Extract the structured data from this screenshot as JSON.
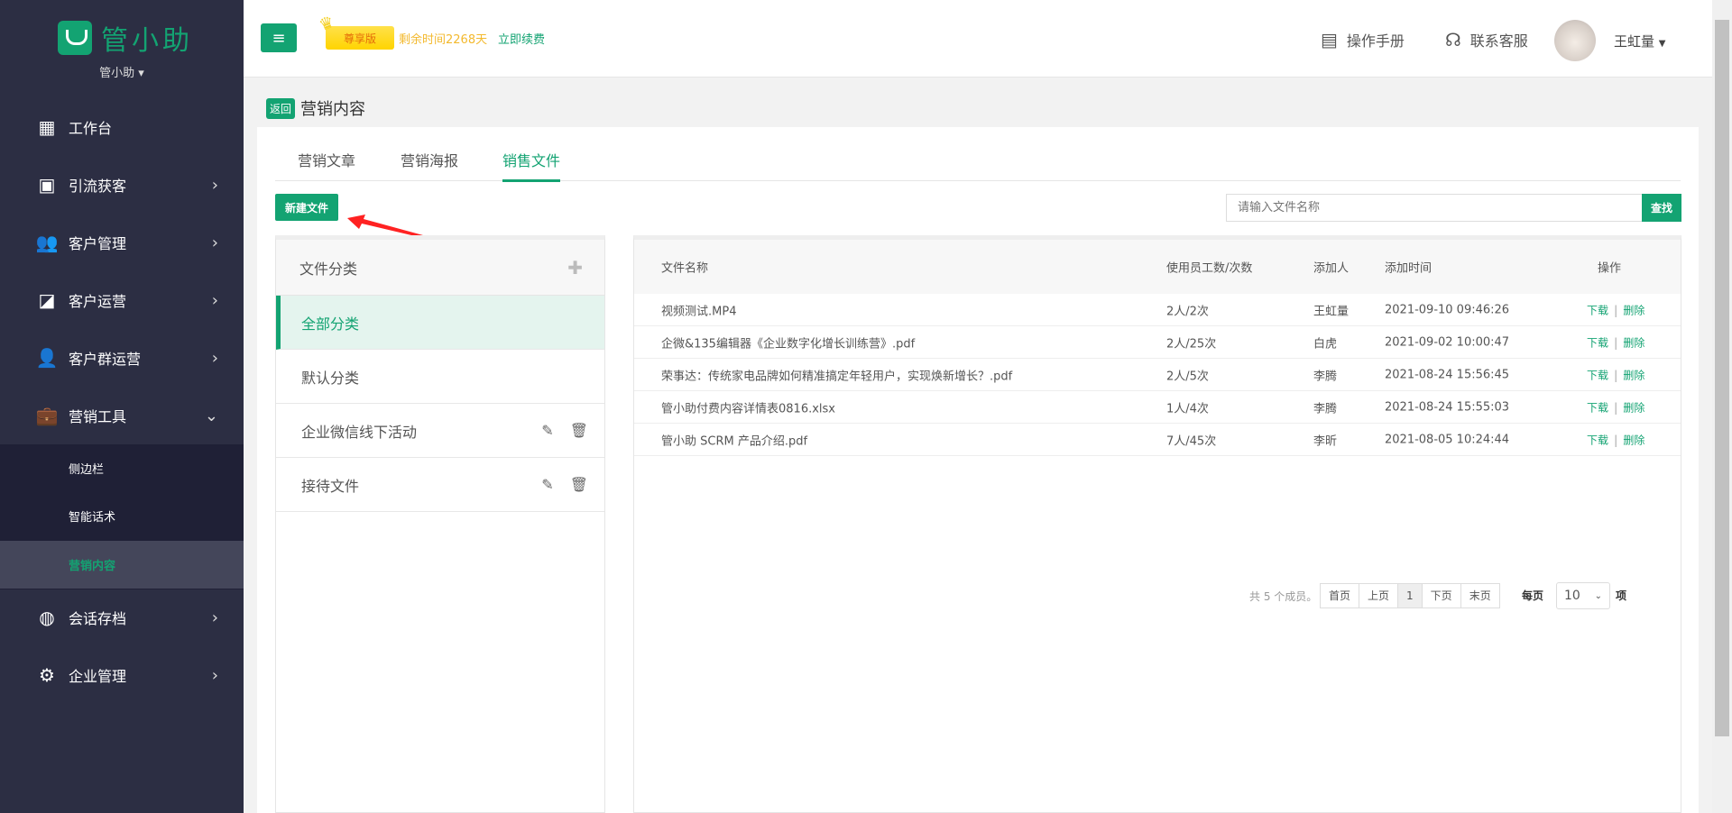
{
  "brand": {
    "logo_text": "管小助",
    "org_name": "管小助"
  },
  "sidebar": {
    "items": [
      {
        "label": "工作台",
        "icon": "dashboard-icon"
      },
      {
        "label": "引流获客",
        "icon": "presentation-icon"
      },
      {
        "label": "客户管理",
        "icon": "users-icon"
      },
      {
        "label": "客户运营",
        "icon": "chart-board-icon"
      },
      {
        "label": "客户群运营",
        "icon": "group-icon"
      },
      {
        "label": "营销工具",
        "icon": "briefcase-icon"
      },
      {
        "label": "会话存档",
        "icon": "chat-archive-icon"
      },
      {
        "label": "企业管理",
        "icon": "gear-icon"
      }
    ],
    "sub_items": [
      {
        "label": "侧边栏"
      },
      {
        "label": "智能话术"
      },
      {
        "label": "营销内容",
        "active": true
      }
    ]
  },
  "header": {
    "edition": "尊享版",
    "remaining": "剩余时间2268天",
    "renew": "立即续费",
    "manual": "操作手册",
    "support": "联系客服",
    "user": "王虹量"
  },
  "page": {
    "back": "返回",
    "title": "营销内容"
  },
  "tabs": [
    {
      "label": "营销文章"
    },
    {
      "label": "营销海报"
    },
    {
      "label": "销售文件",
      "active": true
    }
  ],
  "toolbar": {
    "new_file": "新建文件",
    "search_placeholder": "请输入文件名称",
    "search": "查找"
  },
  "categories": {
    "header": "文件分类",
    "items": [
      {
        "label": "全部分类",
        "active": true
      },
      {
        "label": "默认分类"
      },
      {
        "label": "企业微信线下活动",
        "editable": true
      },
      {
        "label": "接待文件",
        "editable": true
      }
    ]
  },
  "table": {
    "columns": [
      "文件名称",
      "使用员工数/次数",
      "添加人",
      "添加时间",
      "操作"
    ],
    "rows": [
      [
        "视频测试.MP4",
        "2人/2次",
        "王虹量",
        "2021-09-10 09:46:26"
      ],
      [
        "企微&135编辑器《企业数字化增长训练营》.pdf",
        "2人/25次",
        "白虎",
        "2021-09-02 10:00:47"
      ],
      [
        "荣事达：传统家电品牌如何精准搞定年轻用户，实现焕新增长？.pdf",
        "2人/5次",
        "李腾",
        "2021-08-24 15:56:45"
      ],
      [
        "管小助付费内容详情表0816.xlsx",
        "1人/4次",
        "李腾",
        "2021-08-24 15:55:03"
      ],
      [
        "管小助 SCRM 产品介绍.pdf",
        "7人/45次",
        "李昕",
        "2021-08-05 10:24:44"
      ]
    ],
    "download": "下载",
    "delete": "删除"
  },
  "pagination": {
    "total": "共 5 个成员。",
    "first": "首页",
    "prev": "上页",
    "current": "1",
    "next": "下页",
    "last": "末页",
    "per_page_label": "每页",
    "per_page": "10",
    "unit": "项"
  },
  "colors": {
    "accent": "#13a372",
    "sidebar": "#2c2e43"
  }
}
